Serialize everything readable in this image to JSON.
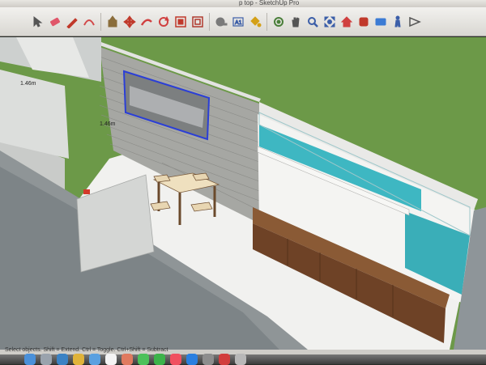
{
  "window": {
    "title": "p top - SketchUp Pro"
  },
  "toolbar": {
    "tools": [
      {
        "icon": "select-arrow-icon",
        "color": "#555555"
      },
      {
        "icon": "eraser-icon",
        "color": "#e0566a"
      },
      {
        "icon": "pencil-line-icon",
        "color": "#c0392b"
      },
      {
        "icon": "arc-icon",
        "color": "#d24a4a"
      },
      {
        "icon": "push-pull-icon",
        "color": "#8a6d3b"
      },
      {
        "icon": "move-icon",
        "color": "#c0392b"
      },
      {
        "icon": "follow-me-icon",
        "color": "#d04040"
      },
      {
        "icon": "rotate-icon",
        "color": "#d04040"
      },
      {
        "icon": "scale-icon",
        "color": "#c0392b"
      },
      {
        "icon": "offset-icon",
        "color": "#b03a2e"
      },
      {
        "icon": "tape-measure-icon",
        "color": "#7a7a7a"
      },
      {
        "icon": "text-icon",
        "color": "#3b5ea8"
      },
      {
        "icon": "paint-bucket-icon",
        "color": "#d4a017"
      },
      {
        "icon": "orbit-icon",
        "color": "#4a7f3a"
      },
      {
        "icon": "pan-hand-icon",
        "color": "#555555"
      },
      {
        "icon": "zoom-icon",
        "color": "#3b5ea8"
      },
      {
        "icon": "zoom-extents-icon",
        "color": "#3b5ea8"
      },
      {
        "icon": "warehouse-icon",
        "color": "#d04040"
      },
      {
        "icon": "extension-icon",
        "color": "#c0392b"
      },
      {
        "icon": "layout-icon",
        "color": "#3b7bd4"
      },
      {
        "icon": "walk-icon",
        "color": "#3b5ea8"
      },
      {
        "icon": "position-camera-icon",
        "color": "#555555"
      }
    ]
  },
  "viewport": {
    "dimension_labels": [
      "1.46m",
      "1.46m"
    ],
    "colors": {
      "ground": "#6e9a49",
      "wall": "#d7d8d6",
      "brick": "#9a9b98",
      "glass": "#3fb8c4",
      "wood": "#7a4a2a",
      "floor": "#eeeeec",
      "selection": "#2b3fd6"
    }
  },
  "status": {
    "text": "Select objects. Shift = Extend. Ctrl = Toggle. Ctrl+Shift = Subtract"
  },
  "dock": {
    "items": [
      "finder-icon",
      "launchpad-icon",
      "safari-icon",
      "chrome-icon",
      "mail-icon",
      "calendar-icon",
      "photos-icon",
      "messages-icon",
      "facetime-icon",
      "music-icon",
      "appstore-icon",
      "settings-icon",
      "sketchup-icon",
      "trash-icon"
    ]
  }
}
